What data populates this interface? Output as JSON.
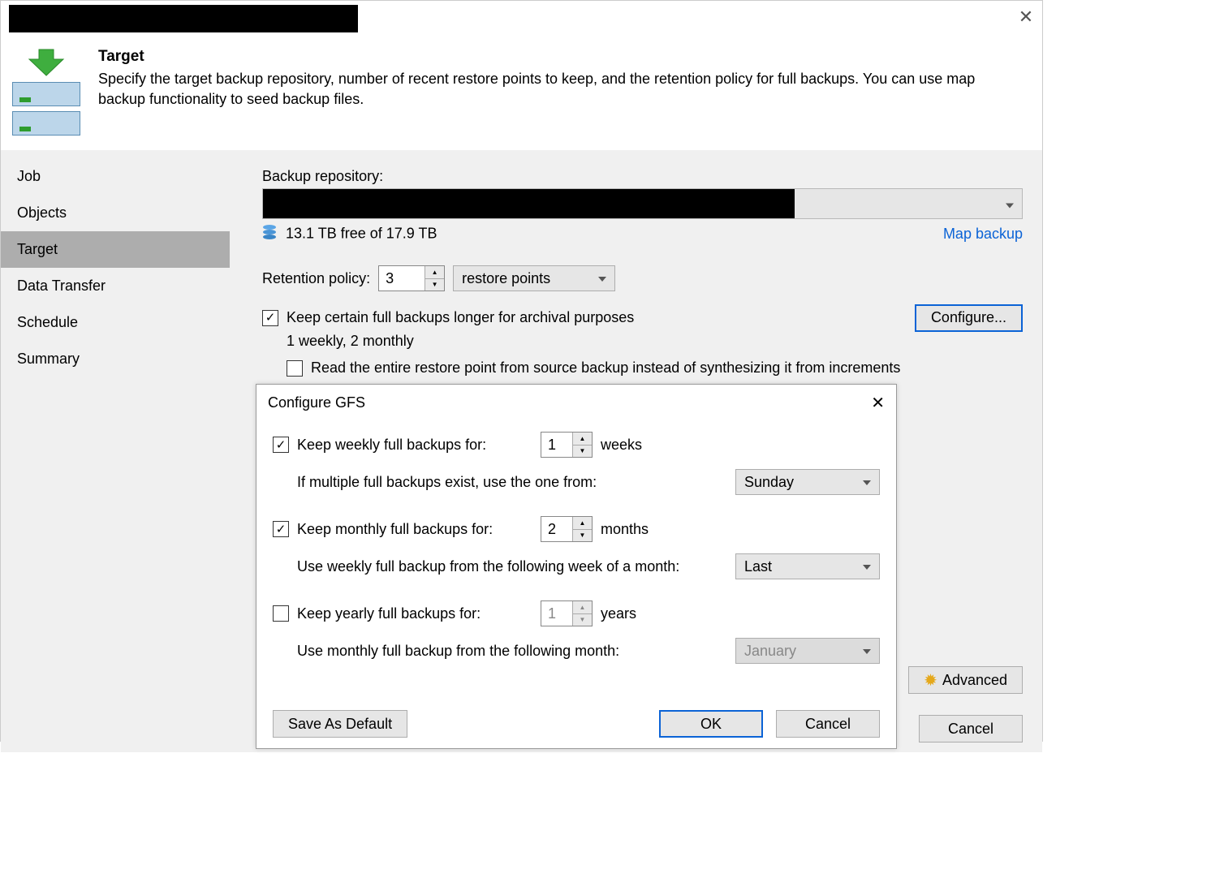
{
  "header": {
    "title": "Target",
    "description": "Specify the target backup repository, number of recent restore points to keep, and the retention policy for full backups. You can use map backup functionality to seed backup files."
  },
  "sidebar": {
    "items": [
      {
        "label": "Job"
      },
      {
        "label": "Objects"
      },
      {
        "label": "Target",
        "active": true
      },
      {
        "label": "Data Transfer"
      },
      {
        "label": "Schedule"
      },
      {
        "label": "Summary"
      }
    ]
  },
  "main": {
    "repo_label": "Backup repository:",
    "free_space": "13.1 TB free of 17.9 TB",
    "map_backup": "Map backup",
    "retention_label": "Retention policy:",
    "retention_value": "3",
    "retention_unit": "restore points",
    "keep_full_label": "Keep certain full backups longer for archival purposes",
    "keep_full_checked": true,
    "keep_full_summary": "1 weekly, 2 monthly",
    "read_entire_label": "Read the entire restore point from source backup instead of synthesizing it from increments",
    "read_entire_checked": false,
    "configure_btn": "Configure...",
    "advanced_btn": "Advanced"
  },
  "footer": {
    "cancel": "Cancel"
  },
  "modal": {
    "title": "Configure GFS",
    "weekly": {
      "checked": true,
      "label": "Keep weekly full backups for:",
      "value": "1",
      "unit": "weeks",
      "sub_label": "If multiple full backups exist, use the one from:",
      "select": "Sunday"
    },
    "monthly": {
      "checked": true,
      "label": "Keep monthly full backups for:",
      "value": "2",
      "unit": "months",
      "sub_label": "Use weekly full backup from the following week of a month:",
      "select": "Last"
    },
    "yearly": {
      "checked": false,
      "label": "Keep yearly full backups for:",
      "value": "1",
      "unit": "years",
      "sub_label": "Use monthly full backup from the following month:",
      "select": "January"
    },
    "save_default": "Save As Default",
    "ok": "OK",
    "cancel": "Cancel"
  }
}
